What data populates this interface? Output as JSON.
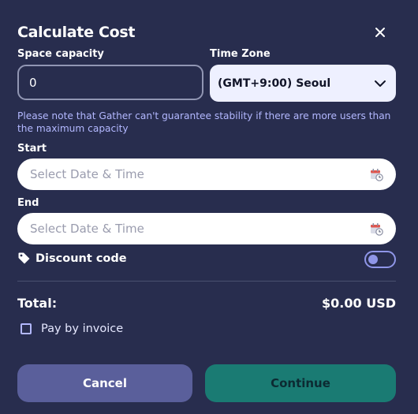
{
  "dialog": {
    "title": "Calculate Cost",
    "space_capacity_label": "Space capacity",
    "space_capacity_value": "0",
    "time_zone_label": "Time Zone",
    "time_zone_value": "(GMT+9:00) Seoul",
    "note": "Please note that Gather can't guarantee stability if there are more users than the maximum capacity",
    "start_label": "Start",
    "start_placeholder": "Select Date & Time",
    "end_label": "End",
    "end_placeholder": "Select Date & Time",
    "discount_label": "Discount code",
    "discount_enabled": false,
    "total_label": "Total:",
    "total_value": "$0.00 USD",
    "invoice_label": "Pay by invoice",
    "invoice_checked": false,
    "cancel_label": "Cancel",
    "continue_label": "Continue"
  },
  "icons": {
    "close": "close-icon",
    "dropdown": "chevron-down-icon",
    "calendar": "calendar-clock-icon",
    "tag": "tag-icon"
  },
  "colors": {
    "background": "#282d4e",
    "note_text": "#b3b8ff",
    "cancel_button": "#5a5f9b",
    "continue_button": "#1a7b73",
    "toggle_accent": "#8f96e8"
  }
}
